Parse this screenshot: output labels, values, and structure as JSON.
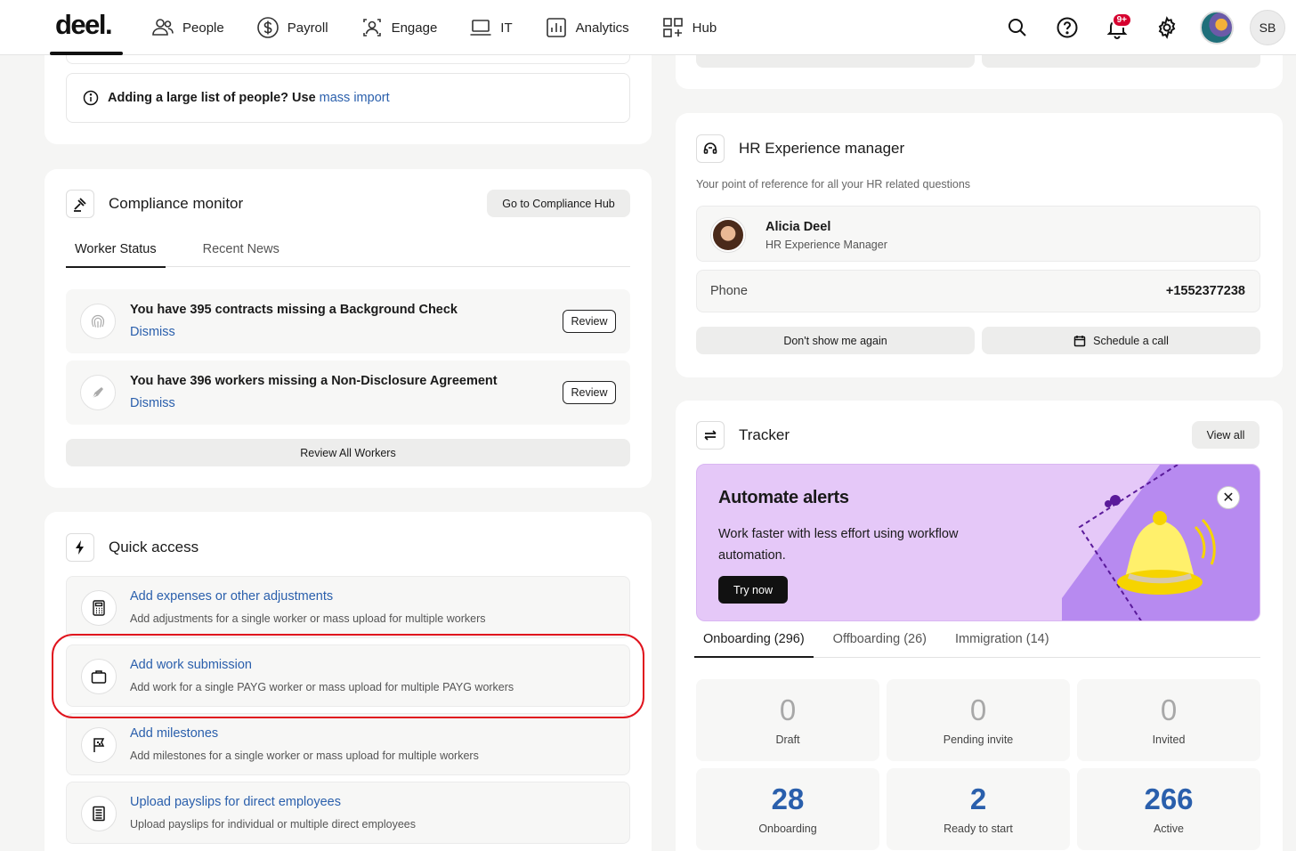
{
  "nav": {
    "logo": "deel.",
    "items": [
      {
        "label": "People",
        "icon": "people-icon"
      },
      {
        "label": "Payroll",
        "icon": "dollar-icon"
      },
      {
        "label": "Engage",
        "icon": "engage-icon"
      },
      {
        "label": "IT",
        "icon": "laptop-icon"
      },
      {
        "label": "Analytics",
        "icon": "analytics-icon"
      },
      {
        "label": "Hub",
        "icon": "hub-icon"
      }
    ],
    "notification_badge": "9+",
    "user_initials": "SB"
  },
  "import_note": {
    "text": "Adding a large list of people? Use",
    "link": "mass import"
  },
  "compliance": {
    "title": "Compliance monitor",
    "hub_button": "Go to Compliance Hub",
    "tabs": [
      "Worker Status",
      "Recent News"
    ],
    "alerts": [
      {
        "text": "You have 395 contracts missing a Background Check",
        "dismiss": "Dismiss",
        "review": "Review",
        "icon": "fingerprint-icon"
      },
      {
        "text": "You have 396 workers missing a Non-Disclosure Agreement",
        "dismiss": "Dismiss",
        "review": "Review",
        "icon": "pen-nib-icon"
      }
    ],
    "review_all": "Review All Workers"
  },
  "quick_access": {
    "title": "Quick access",
    "items": [
      {
        "title": "Add expenses or other adjustments",
        "desc": "Add adjustments for a single worker or mass upload for multiple workers",
        "icon": "calculator-icon"
      },
      {
        "title": "Add work submission",
        "desc": "Add work for a single PAYG worker or mass upload for multiple PAYG workers",
        "icon": "briefcase-icon"
      },
      {
        "title": "Add milestones",
        "desc": "Add milestones for a single worker or mass upload for multiple workers",
        "icon": "flag-icon"
      },
      {
        "title": "Upload payslips for direct employees",
        "desc": "Upload payslips for individual or multiple direct employees",
        "icon": "receipt-icon"
      }
    ]
  },
  "hr_manager": {
    "title": "HR Experience manager",
    "subtitle": "Your point of reference for all your HR related questions",
    "name": "Alicia Deel",
    "role": "HR Experience Manager",
    "phone_label": "Phone",
    "phone": "+1552377238",
    "dont_show": "Don't show me again",
    "schedule": "Schedule a call"
  },
  "tracker": {
    "title": "Tracker",
    "view_all": "View all",
    "banner": {
      "title": "Automate alerts",
      "text": "Work faster with less effort using workflow automation.",
      "button": "Try now",
      "close": "✕"
    },
    "tabs": [
      "Onboarding (296)",
      "Offboarding (26)",
      "Immigration (14)"
    ],
    "stats": [
      {
        "value": "0",
        "label": "Draft"
      },
      {
        "value": "0",
        "label": "Pending invite"
      },
      {
        "value": "0",
        "label": "Invited"
      },
      {
        "value": "28",
        "label": "Onboarding"
      },
      {
        "value": "2",
        "label": "Ready to start"
      },
      {
        "value": "266",
        "label": "Active"
      }
    ]
  },
  "colors": {
    "link": "#2a5fac",
    "highlight": "#e0141e",
    "banner_bg": "#e5c8f8",
    "badge": "#d6002f"
  }
}
